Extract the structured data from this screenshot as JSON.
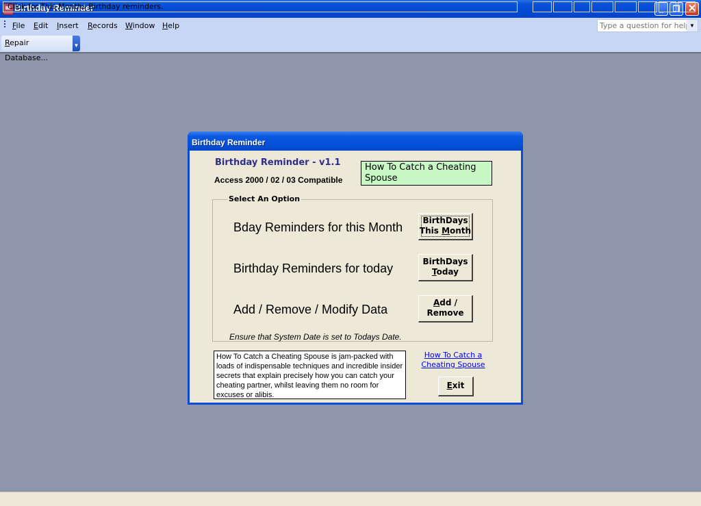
{
  "window": {
    "title": "Birthday Reminder",
    "icon": "access-app-icon",
    "controls": {
      "minimize": "_",
      "restore": "❐",
      "close": "✕"
    }
  },
  "menubar": {
    "items": [
      {
        "label": "File",
        "accel": "F",
        "rest": "ile"
      },
      {
        "label": "Edit",
        "accel": "E",
        "rest": "dit"
      },
      {
        "label": "Insert",
        "accel": "I",
        "rest": "nsert"
      },
      {
        "label": "Records",
        "accel": "R",
        "rest": "ecords"
      },
      {
        "label": "Window",
        "accel": "W",
        "rest": "indow"
      },
      {
        "label": "Help",
        "accel": "H",
        "rest": "elp"
      }
    ],
    "help_placeholder": "Type a question for help",
    "help_dropdown": "▼"
  },
  "toolbar": {
    "repair_accel": "R",
    "repair_rest": "epair Database...",
    "overflow": "▼"
  },
  "dialog": {
    "title": "Birthday Reminder",
    "app_name": "Birthday Reminder - v1.1",
    "compat": "Access 2000 / 02 / 03 Compatible",
    "promo_box": "How To Catch a Cheating Spouse",
    "options_legend": "Select An Option",
    "options": [
      {
        "label": "Bday Reminders for this Month",
        "btn_line1": "BirthDays",
        "btn_line2_pre": "This ",
        "btn_line2_accel": "M",
        "btn_line2_post": "onth"
      },
      {
        "label": "Birthday Reminders for today",
        "btn_line1": "BirthDays",
        "btn_line2_pre": "",
        "btn_line2_accel": "T",
        "btn_line2_post": "oday"
      },
      {
        "label": "Add / Remove / Modify Data",
        "btn_line1_accel": "A",
        "btn_line1_post": "dd /",
        "btn_line2": "Remove"
      }
    ],
    "note": "Ensure that System Date is set to Todays Date.",
    "description": "How To Catch a Cheating Spouse is jam-packed with loads of indispensable techniques and incredible insider secrets that explain precisely how you can catch your cheating partner, whilst leaving them no room for excuses or alibis.",
    "promo_link": "How To Catch a Cheating Spouse",
    "exit_accel": "E",
    "exit_rest": "xit"
  },
  "statusbar": {
    "text": "Click for This Months Birthday reminders."
  }
}
